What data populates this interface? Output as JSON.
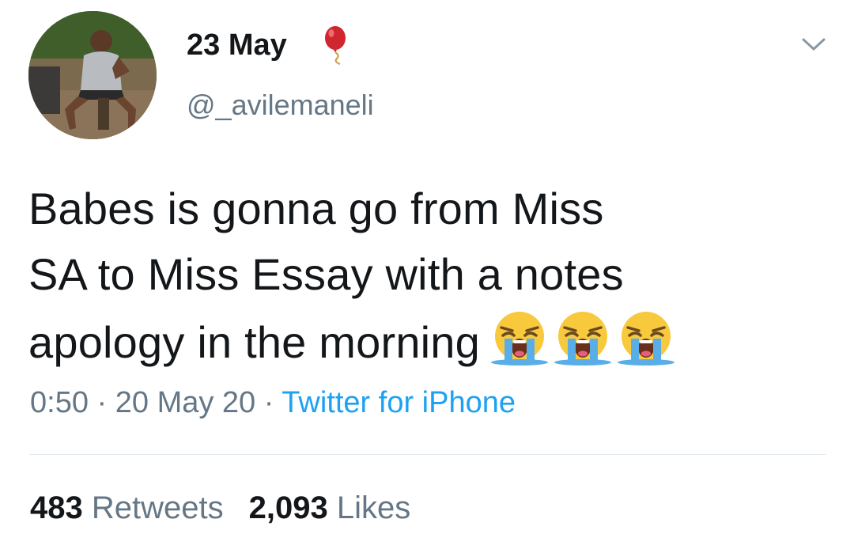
{
  "header": {
    "display_name": "23 May",
    "name_emoji_icon": "balloon-icon",
    "handle": "@_avilemaneli",
    "menu_icon": "chevron-down-icon"
  },
  "tweet": {
    "lines": [
      "Babes is gonna go from Miss",
      "SA to Miss Essay with a notes",
      "apology in the morning"
    ],
    "emojis": [
      "loudly-crying-face-icon",
      "loudly-crying-face-icon",
      "loudly-crying-face-icon"
    ]
  },
  "meta": {
    "time": "0:50",
    "separator": "·",
    "date": "20 May 20",
    "source": "Twitter for iPhone"
  },
  "stats": {
    "retweets_count": "483",
    "retweets_label": "Retweets",
    "likes_count": "2,093",
    "likes_label": "Likes"
  },
  "colors": {
    "text": "#14171a",
    "secondary": "#657786",
    "link": "#1da1f2",
    "divider": "#e1e8ed"
  }
}
